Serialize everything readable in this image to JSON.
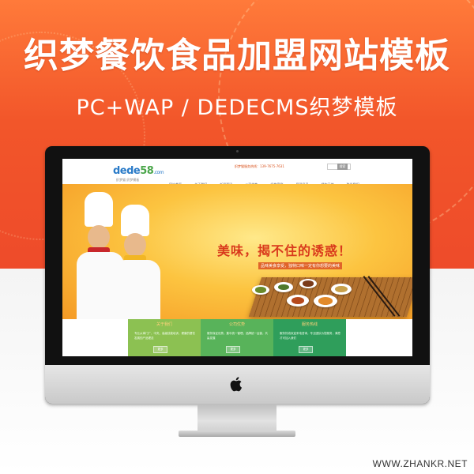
{
  "banner": {
    "title": "织梦餐饮食品加盟网站模板",
    "subtitle": "PC+WAP / DEDECMS织梦模板"
  },
  "site": {
    "logo_main": "dede",
    "logo_five": "58",
    "logo_dom": ".com",
    "logo_sub": "织梦猫  织梦模板",
    "hotline": "织梦猫服务热线：139-7675-7631",
    "search_button": "搜索",
    "nav": [
      "网站首页",
      "关于我们",
      "新闻资讯",
      "公司优势",
      "经典案例",
      "展现风采",
      "餐饮天地",
      "联系我们"
    ],
    "slogan": "美味，揭不住的诱惑！",
    "slogan_tag": "品味美食享受，独特口味一定有你想要的美味",
    "boxes": [
      {
        "title": "关于我们",
        "text": "专业从事门厂、中央、高级技能培训，健康的餐饮发展的产品理念",
        "button": "更多"
      },
      {
        "title": "公司优势",
        "text": "服务保证优势，集中统一管理，品牌统一运营，共赢发展",
        "button": "更多"
      },
      {
        "title": "服务热线",
        "text": "服务热线欢迎来电咨询，专业团队为您服务，满意才可加入我们",
        "button": "更多"
      }
    ]
  },
  "watermark": "WWW.ZHANKR.NET",
  "colors": {
    "banner_top": "#ff7a3a",
    "banner_bottom": "#ee4b2a",
    "box1": "#8cc152",
    "box2": "#58b35a",
    "box3": "#2f9e5b"
  }
}
